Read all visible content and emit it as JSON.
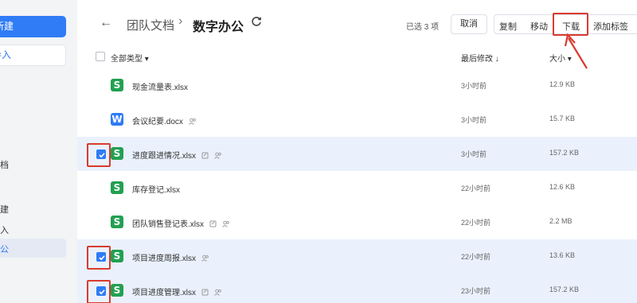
{
  "sidebar": {
    "new_label": "新建",
    "import_label": "导入",
    "items": [
      "档",
      "建",
      "入",
      "公"
    ]
  },
  "header": {
    "back": "←",
    "breadcrumb_parent": "团队文档",
    "separator": "›",
    "current": "数字办公",
    "selected_count": "已选 3 项",
    "cancel": "取消",
    "copy": "复制",
    "move": "移动",
    "download": "下载",
    "add_tag": "添加标签"
  },
  "columns": {
    "type": "全部类型 ▾",
    "modified": "最后修改 ↓",
    "size": "大小 ▾"
  },
  "files": [
    {
      "icon": "S",
      "kind": "xls",
      "name": "现金流量表.xlsx",
      "time": "3小时前",
      "size": "12.9 KB",
      "selected": false
    },
    {
      "icon": "W",
      "kind": "doc",
      "name": "会议纪要.docx",
      "time": "3小时前",
      "size": "15.7 KB",
      "selected": false
    },
    {
      "icon": "S",
      "kind": "xls",
      "name": "进度跟进情况.xlsx",
      "time": "3小时前",
      "size": "157.2 KB",
      "selected": true
    },
    {
      "icon": "S",
      "kind": "xls",
      "name": "库存登记.xlsx",
      "time": "22小时前",
      "size": "12.6 KB",
      "selected": false
    },
    {
      "icon": "S",
      "kind": "xls",
      "name": "团队销售登记表.xlsx",
      "time": "22小时前",
      "size": "2.2 MB",
      "selected": false
    },
    {
      "icon": "S",
      "kind": "xls",
      "name": "项目进度周报.xlsx",
      "time": "22小时前",
      "size": "13.6 KB",
      "selected": true
    },
    {
      "icon": "S",
      "kind": "xls",
      "name": "项目进度管理.xlsx",
      "time": "23小时前",
      "size": "157.2 KB",
      "selected": true
    }
  ],
  "colors": {
    "accent": "#2f7cf6",
    "excel": "#22a052",
    "highlight": "#d93b30",
    "selected_row": "#eaf1fc"
  }
}
